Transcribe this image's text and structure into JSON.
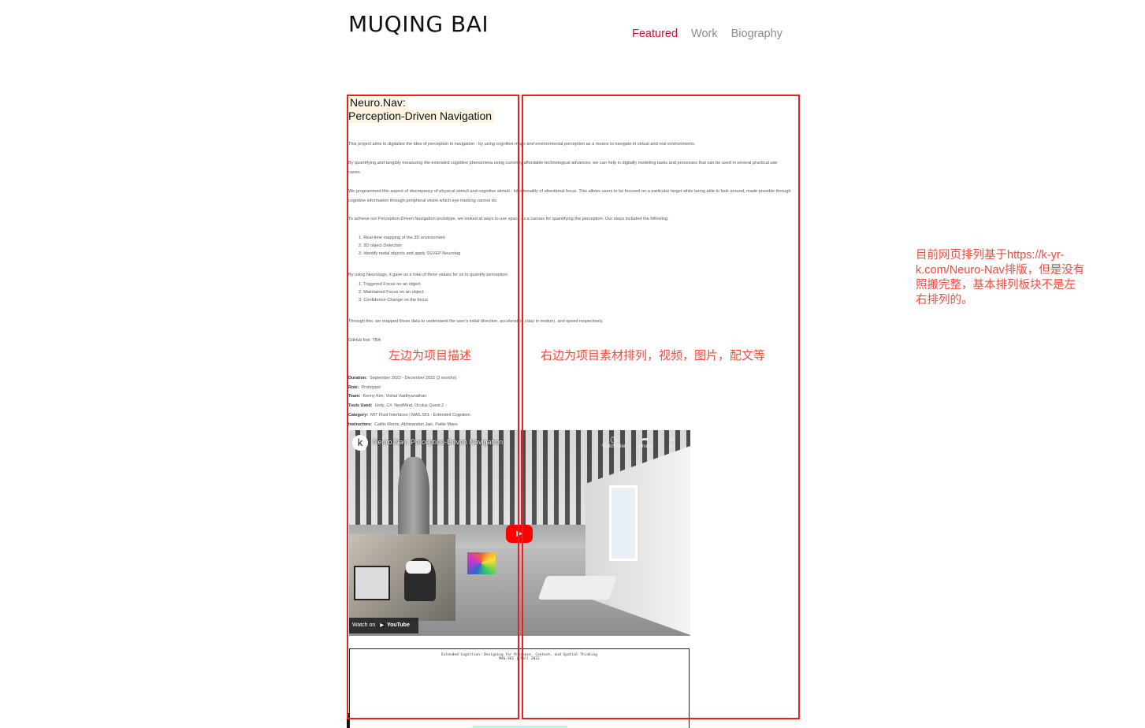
{
  "site": {
    "title": "MUQING BAI",
    "nav": [
      {
        "label": "Featured",
        "active": true
      },
      {
        "label": "Work",
        "active": false
      },
      {
        "label": "Biography",
        "active": false
      }
    ],
    "accent_color": "#d1112f"
  },
  "project": {
    "title_line1": "Neuro.Nav:",
    "title_line2": "Perception-Driven Navigation",
    "paragraphs": [
      "This project aims to digitalize the idea of perception in navigation - by using cognitive maps and environmental perception as a means to navigate in virtual and real environments.",
      "By quantifying and tangibly measuring the extended cognitive phenomena using currently affordable technological advances, we can help in digitally modeling tasks and processes that can be used in several practical use cases.",
      "We programmed this aspect of discrepancy of physical stimuli and cognitive stimuli - intentionality of attentional focus. This allows users to be focused on a particular target while being able to look around, made possible through cognitive information through peripheral vision which eye tracking cannot do.",
      "To achieve our Perception-Driven Navigation prototype, we looked at ways to use space as a canvas for quantifying the perception. Our steps included the following:"
    ],
    "steps": [
      "1. Real-time mapping of the 3D environment",
      "2. 3D object Detection",
      "3. Identify nodal objects and apply SSVEP Neurotag"
    ],
    "values_intro": "By using Neurotags, it gave us a total of three values for us to quantify perception:",
    "values": [
      "1. Triggered Focus on an object",
      "2. Maintained Focus on an object",
      "3. Confidence-Change on the focus"
    ],
    "mapping_text": "Through this, we mapped these data to understand the user's initial direction, acceleration (stay in motion), and speed respectively.",
    "github": "GitHub link: TBA",
    "meta": [
      {
        "label": "Duration:",
        "value": "September 2022 - December 2022 (3 months)"
      },
      {
        "label": "Role:",
        "value": "Prototyper"
      },
      {
        "label": "Team:",
        "value": "Kenny Kim, Vishal Vaidhyanathan"
      },
      {
        "label": "Tools Used:",
        "value": "Unity, C#, NextMind, Oculus Quest 2"
      },
      {
        "label": "Category:",
        "value": "MIT Fluid Interfaces | MAS.S61 - Extended Cognition"
      },
      {
        "label": "Instructors:",
        "value": "Caitlin Morris, Abhinandan Jain, Pattie Maes"
      }
    ]
  },
  "video": {
    "channel_initial": "k",
    "title": "Neuro.Nav: Perception-Driven Navigation",
    "watch_later": "Watch later",
    "share": "Share",
    "playlist_count": "1/1",
    "watch_on": "Watch on",
    "youtube": "YouTube"
  },
  "doc_embed": {
    "line1": "Extended Cognition: Designing for Presence, Context, and Spatial Thinking",
    "line2": "MAS.S61 | Fall 2022"
  },
  "annotations": {
    "left_label": "左边为项目描述",
    "right_label": "右边为项目素材排列，视频，图片，配文等",
    "note": "目前网页排列基于https://k-yr-k.com/Neuro-Nav排版，但是没有照搬完整，基本排列板块不是左右排列的。",
    "color": "#e32222"
  }
}
